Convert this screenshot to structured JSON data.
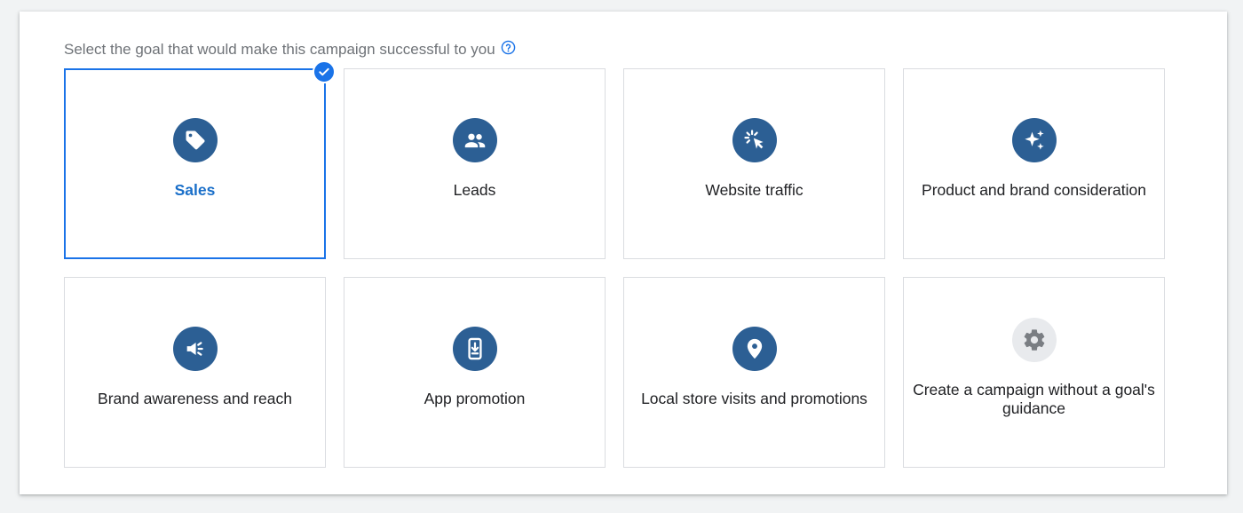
{
  "prompt": {
    "text": "Select the goal that would make this campaign successful to you",
    "help_icon": "help-circle-icon"
  },
  "colors": {
    "accent": "#1a73e8",
    "icon_bg": "#2c5f94",
    "icon_bg_muted": "#e8eaed",
    "border": "#dadce0"
  },
  "goals": [
    {
      "label": "Sales",
      "icon": "tag-icon",
      "selected": true
    },
    {
      "label": "Leads",
      "icon": "people-icon",
      "selected": false
    },
    {
      "label": "Website traffic",
      "icon": "cursor-click-icon",
      "selected": false
    },
    {
      "label": "Product and brand consideration",
      "icon": "sparkle-icon",
      "selected": false
    },
    {
      "label": "Brand awareness and reach",
      "icon": "megaphone-icon",
      "selected": false
    },
    {
      "label": "App promotion",
      "icon": "phone-download-icon",
      "selected": false
    },
    {
      "label": "Local store visits and promotions",
      "icon": "location-pin-icon",
      "selected": false
    },
    {
      "label": "Create a campaign without a goal's guidance",
      "icon": "gear-icon",
      "selected": false
    }
  ]
}
